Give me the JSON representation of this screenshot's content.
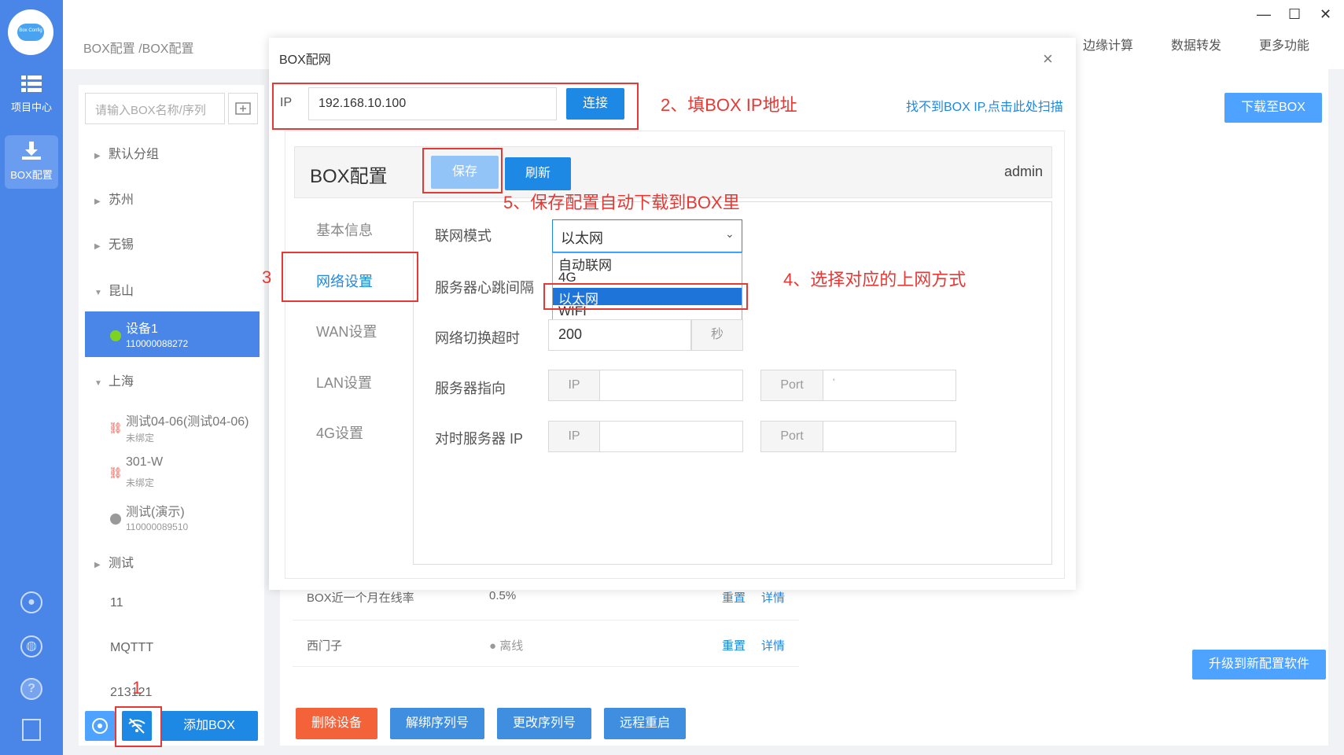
{
  "breadcrumb": "BOX配置 /BOX配置",
  "top_nav": [
    "边缘计算",
    "数据转发",
    "更多功能"
  ],
  "window_controls": {
    "minimize": "—",
    "maximize": "☐",
    "close": "✕"
  },
  "rail": {
    "logo_text": "Box Config",
    "items": [
      {
        "label": "项目中心",
        "icon": "list-icon"
      },
      {
        "label": "BOX配置",
        "icon": "download-icon"
      }
    ],
    "bottom_icons": [
      "user-icon",
      "globe-icon",
      "help-icon",
      "exit-icon"
    ],
    "help_glyph": "?"
  },
  "left_panel": {
    "search_placeholder": "请输入BOX名称/序列",
    "tree": [
      {
        "label": "默认分组",
        "arrow": "▶"
      },
      {
        "label": "苏州",
        "arrow": "▶"
      },
      {
        "label": "无锡",
        "arrow": "▶"
      },
      {
        "label": "昆山",
        "arrow": "▼"
      },
      {
        "label": "上海",
        "arrow": "▼"
      },
      {
        "label": "测试",
        "arrow": "▶"
      },
      {
        "label": "11"
      },
      {
        "label": "MQTTT"
      },
      {
        "label": "213121"
      }
    ],
    "devices": [
      {
        "name": "设备1",
        "sn": "110000088272",
        "status_color": "#7ed321"
      },
      {
        "name": "测试04-06(测试04-06)",
        "sn": "未绑定"
      },
      {
        "name": "301-W",
        "sn": "未绑定"
      },
      {
        "name": "测试(演示)",
        "sn": "110000089510",
        "status_color": "#999999"
      }
    ],
    "add_box_label": "添加BOX"
  },
  "main": {
    "download_label": "下载至BOX",
    "upgrade_label": "升级到新配置软件",
    "rows": [
      {
        "name": "BOX近一个月在线率",
        "value": "0.5%",
        "reset": "重置",
        "detail": "详情"
      },
      {
        "name": "西门子",
        "value": "● 离线",
        "reset": "重置",
        "detail": "详情"
      }
    ],
    "actions": [
      {
        "label": "删除设备",
        "color": "#f4623a"
      },
      {
        "label": "解绑序列号",
        "color": "#3f8ee0"
      },
      {
        "label": "更改序列号",
        "color": "#3f8ee0"
      },
      {
        "label": "远程重启",
        "color": "#3f8ee0"
      }
    ]
  },
  "dialog": {
    "title": "BOX配网",
    "close": "×",
    "ip_label": "IP",
    "ip_value": "192.168.10.100",
    "connect_label": "连接",
    "scan_link": "找不到BOX IP,点击此处扫描",
    "config_title": "BOX配置",
    "save_label": "保存",
    "refresh_label": "刷新",
    "user": "admin",
    "tabs": [
      "基本信息",
      "网络设置",
      "WAN设置",
      "LAN设置",
      "4G设置"
    ],
    "active_tab": "网络设置",
    "fields": {
      "mode_label": "联网模式",
      "mode_value": "以太网",
      "mode_options": [
        "自动联网",
        "4G",
        "以太网",
        "WIFI"
      ],
      "heartbeat_label": "服务器心跳间隔",
      "switch_timeout_label": "网络切换超时",
      "switch_timeout_value": "200",
      "switch_timeout_unit": "秒",
      "server_label": "服务器指向",
      "time_server_label": "对时服务器 IP",
      "ip_prefix": "IP",
      "port_prefix": "Port",
      "server_port_mark": "'"
    }
  },
  "annotations": {
    "a1": "1",
    "a2": "2、填BOX IP地址",
    "a3": "3",
    "a4": "4、选择对应的上网方式",
    "a5": "5、保存配置自动下载到BOX里"
  }
}
